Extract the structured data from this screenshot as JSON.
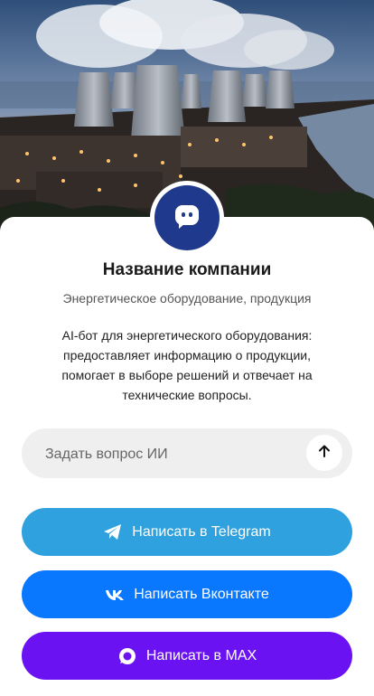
{
  "company": {
    "name": "Название компании",
    "tagline": "Энергетическое оборудование, продукция",
    "description": "AI-бот для энергетического оборудования: предоставляет информацию о продукции, помогает в выборе решений и отвечает на технические вопросы."
  },
  "ask": {
    "placeholder": "Задать вопрос ИИ",
    "value": ""
  },
  "buttons": {
    "telegram": {
      "label": "Написать в Telegram",
      "color": "#2ea1de"
    },
    "vk": {
      "label": "Написать Вконтакте",
      "color": "#0a77ff"
    },
    "max": {
      "label": "Написать в MAX",
      "color": "#6a12f2"
    }
  },
  "icons": {
    "avatar": "chat-bot-icon",
    "send": "arrow-up-icon",
    "telegram": "telegram-icon",
    "vk": "vk-icon",
    "max": "max-icon"
  },
  "colors": {
    "avatar_bg": "#1f3a8c",
    "input_bg": "#efefef"
  }
}
